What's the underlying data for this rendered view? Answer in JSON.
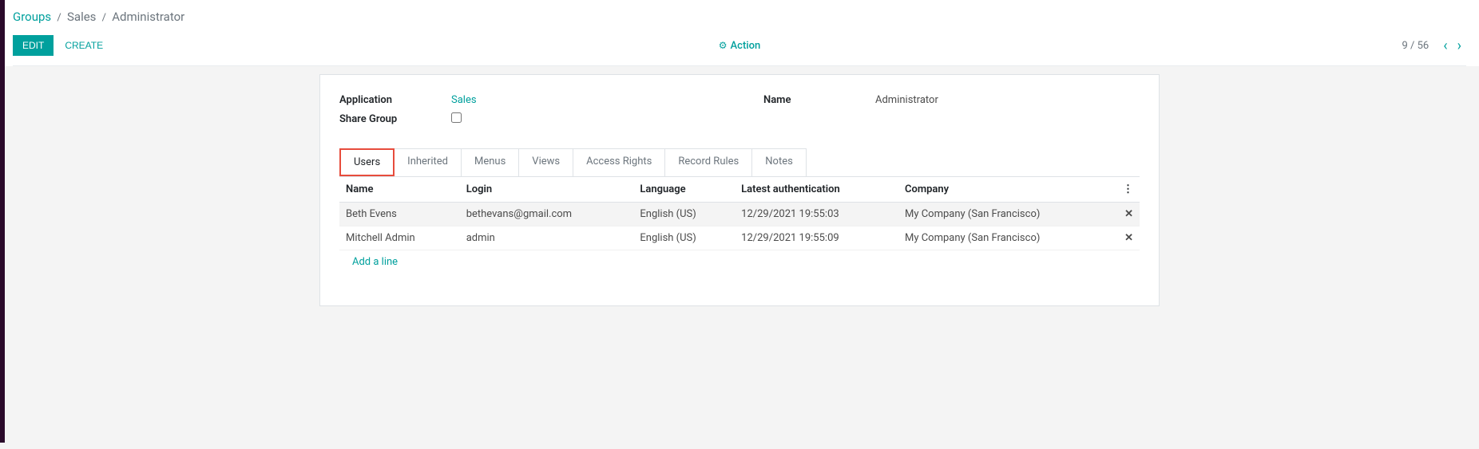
{
  "breadcrumb": {
    "root": "Groups",
    "mid": "Sales",
    "current": "Administrator"
  },
  "toolbar": {
    "edit": "EDIT",
    "create": "CREATE",
    "action": "Action"
  },
  "pager": {
    "position": "9 / 56"
  },
  "form": {
    "application_label": "Application",
    "application_value": "Sales",
    "share_group_label": "Share Group",
    "name_label": "Name",
    "name_value": "Administrator"
  },
  "tabs": [
    {
      "label": "Users",
      "active": true
    },
    {
      "label": "Inherited",
      "active": false
    },
    {
      "label": "Menus",
      "active": false
    },
    {
      "label": "Views",
      "active": false
    },
    {
      "label": "Access Rights",
      "active": false
    },
    {
      "label": "Record Rules",
      "active": false
    },
    {
      "label": "Notes",
      "active": false
    }
  ],
  "table": {
    "columns": {
      "name": "Name",
      "login": "Login",
      "language": "Language",
      "latest_auth": "Latest authentication",
      "company": "Company"
    },
    "rows": [
      {
        "name": "Beth Evens",
        "login": "bethevans@gmail.com",
        "language": "English (US)",
        "latest_auth": "12/29/2021 19:55:03",
        "company": "My Company (San Francisco)"
      },
      {
        "name": "Mitchell Admin",
        "login": "admin",
        "language": "English (US)",
        "latest_auth": "12/29/2021 19:55:09",
        "company": "My Company (San Francisco)"
      }
    ],
    "add_line": "Add a line"
  }
}
